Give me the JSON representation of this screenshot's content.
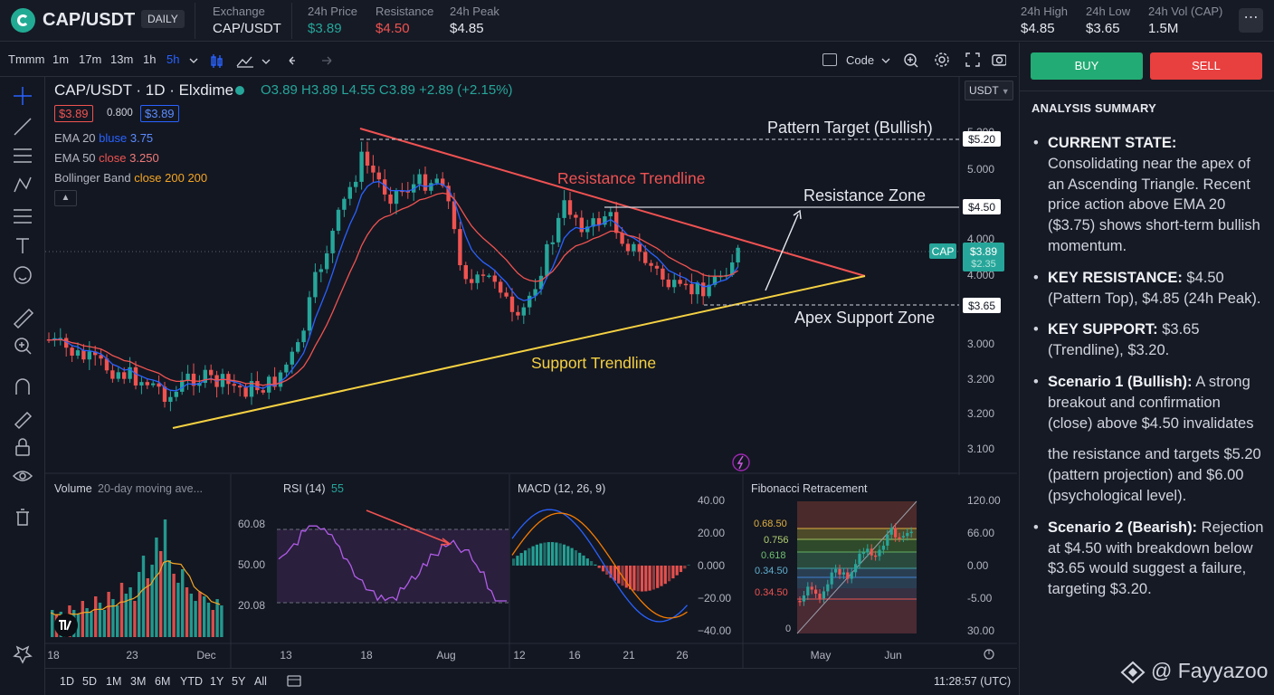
{
  "header": {
    "brand": "CAP/USDT",
    "badge": "DAILY",
    "stats": [
      {
        "label": "Exchange",
        "value": "CAP/USDT",
        "color": "#e6e8ee"
      },
      {
        "label": "24h Price",
        "value": "$3.89",
        "color": "#26a69a"
      },
      {
        "label": "Resistance",
        "value": "$4.50",
        "color": "#ef5350"
      },
      {
        "label": "24h Peak",
        "value": "$4.85",
        "color": "#e6e8ee"
      }
    ],
    "right_stats": [
      {
        "label": "24h High",
        "value": "$4.85"
      },
      {
        "label": "24h Low",
        "value": "$3.65"
      },
      {
        "label": "24h Vol (CAP)",
        "value": "1.5M"
      }
    ],
    "more": "⋯"
  },
  "toolbar": {
    "timeframes": [
      "Tmmm",
      "1m",
      "17m",
      "13m",
      "1h",
      "5h"
    ],
    "active_timeframe": "5h",
    "code_label": "Code"
  },
  "legend": {
    "title": "CAP/USDT · 1D · Elxdime",
    "ohlc": "O3.89  H3.89  L4.55  C3.89  +2.89 (+2.15%)",
    "price_box_1": "$3.89",
    "mid_value": "0.800",
    "price_box_2": "$3.89",
    "ema20": {
      "name": "EMA 20",
      "param": "bluse",
      "value": "3.75"
    },
    "ema50": {
      "name": "EMA 50",
      "param": "close",
      "value": "3.250"
    },
    "bb": {
      "name": "Bollinger Band",
      "param": "close 200 200"
    }
  },
  "annotations": {
    "pattern_target": "Pattern Target (Bullish)",
    "resistance_trendline": "Resistance Trendline",
    "resistance_zone": "Resistance Zone",
    "apex_support": "Apex Support Zone",
    "support_trendline": "Support Trendline"
  },
  "price_axis": {
    "ticks": [
      "5.200",
      "5.000",
      "4.000",
      "4.000",
      "3.000",
      "3.200",
      "3.200",
      "3.100"
    ],
    "labels": {
      "target": "$5.20",
      "resistance": "$4.50",
      "support": "$3.65",
      "current": "$3.89",
      "current_sub": "$2.35",
      "cap_tag": "CAP"
    },
    "currency_select": "USDT"
  },
  "time_axis": [
    "18",
    "23",
    "Dec",
    "13",
    "18",
    "Aug",
    "12",
    "16",
    "21",
    "26",
    "May",
    "Jun"
  ],
  "panels": {
    "volume": {
      "title": "Volume",
      "sub": "20-day moving ave..."
    },
    "rsi": {
      "title": "RSI (14)",
      "value": "55",
      "ticks": [
        "60.08",
        "50.00",
        "20.08"
      ]
    },
    "macd": {
      "title": "MACD (12, 26, 9)",
      "ticks": [
        "40.00",
        "20.00",
        "0.000",
        "−20.00",
        "−40.00"
      ]
    },
    "fib": {
      "title": "Fibonacci Retracement",
      "levels": [
        "0.68.50",
        "0.756",
        "0.618",
        "0.34.50",
        "0.34.50",
        "0"
      ],
      "ticks": [
        "120.00",
        "66.00",
        "0.00",
        "-5.00",
        "30.00"
      ]
    }
  },
  "bottombar": {
    "ranges": [
      "1D",
      "5D",
      "1M",
      "3M",
      "6M",
      "YTD",
      "1Y",
      "5Y",
      "All"
    ],
    "clock": "11:28:57 (UTC)"
  },
  "right_panel": {
    "buy": "BUY",
    "sell": "SELL",
    "summary_title": "ANALYSIS SUMMARY",
    "items": [
      {
        "head": "CURRENT STATE:",
        "text": " Consolidating near the apex of an Ascending Triangle. Recent price action above EMA 20 ($3.75) shows short-term bullish momentum."
      },
      {
        "head": "KEY RESISTANCE:",
        "text": " $4.50 (Pattern Top), $4.85 (24h Peak)."
      },
      {
        "head": "KEY SUPPORT:",
        "text": " $3.65 (Trendline), $3.20."
      },
      {
        "head": "Scenario 1 (Bullish):",
        "text": " A strong breakout and confirmation (close) above $4.50 invalidates"
      },
      {
        "head": "",
        "text": "the resistance and targets $5.20 (pattern projection) and $6.00 (psychological level)."
      },
      {
        "head": "Scenario 2 (Bearish):",
        "text": " Rejection at $4.50 with breakdown below $3.65 would suggest a failure, targeting $3.20."
      }
    ]
  },
  "watermark": "@ Fayyazoo",
  "colors": {
    "up": "#26a69a",
    "down": "#ef5350",
    "resistance_line": "#f05252",
    "support_line": "#f5d142",
    "ema20": "#2962ff",
    "ema50": "#ef5350"
  }
}
